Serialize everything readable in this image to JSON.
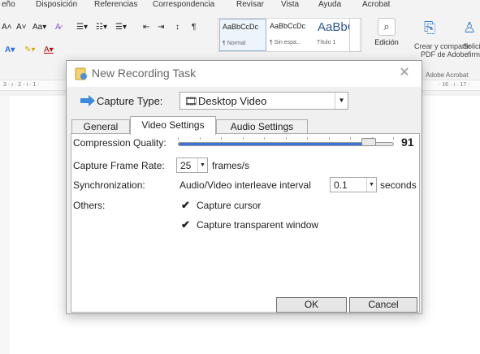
{
  "ribbon": {
    "menu": [
      "eño",
      "Disposición",
      "Referencias",
      "Correspondencia",
      "Revisar",
      "Vista",
      "Ayuda",
      "Acrobat"
    ],
    "styles": [
      {
        "sample": "AaBbCcDc",
        "name": "¶ Normal"
      },
      {
        "sample": "AaBbCcDc",
        "name": "¶ Sin espa..."
      },
      {
        "sample": "AaBbC(",
        "name": "Título 1"
      }
    ],
    "edicion_label": "Edición",
    "adobe_line1": "Crear y compartir",
    "adobe_line2": "PDF de Adobe",
    "adobe_solic1": "Solicitar",
    "adobe_solic2": "firmas",
    "adobe_group": "Adobe Acrobat",
    "ruler_left": "3 · ı · 2 · ı · 1 ·",
    "ruler_right": "· 16 · ı · 17 ·"
  },
  "dialog": {
    "title": "New Recording Task",
    "capture_type_label": "Capture Type:",
    "capture_type_value": "Desktop Video",
    "tabs": [
      "General",
      "Video Settings",
      "Audio Settings"
    ],
    "active_tab": "Video Settings",
    "compression_label": "Compression Quality:",
    "compression_value": "91",
    "compression_level": 0.91,
    "frame_rate_label": "Capture Frame Rate:",
    "frame_rate_value": "25",
    "frame_rate_unit": "frames/s",
    "sync_label": "Synchronization:",
    "sync_desc": "Audio/Video interleave interval",
    "sync_value": "0.1",
    "sync_unit": "seconds",
    "others_label": "Others:",
    "capture_cursor_label": "Capture cursor",
    "capture_cursor_checked": true,
    "capture_transparent_label": "Capture transparent window",
    "capture_transparent_checked": true,
    "ok_label": "OK",
    "cancel_label": "Cancel"
  },
  "colors": {
    "slider_fill": "#3b74d6",
    "dialog_bg": "#f0f0f0",
    "accent_blue": "#3b82c4"
  }
}
